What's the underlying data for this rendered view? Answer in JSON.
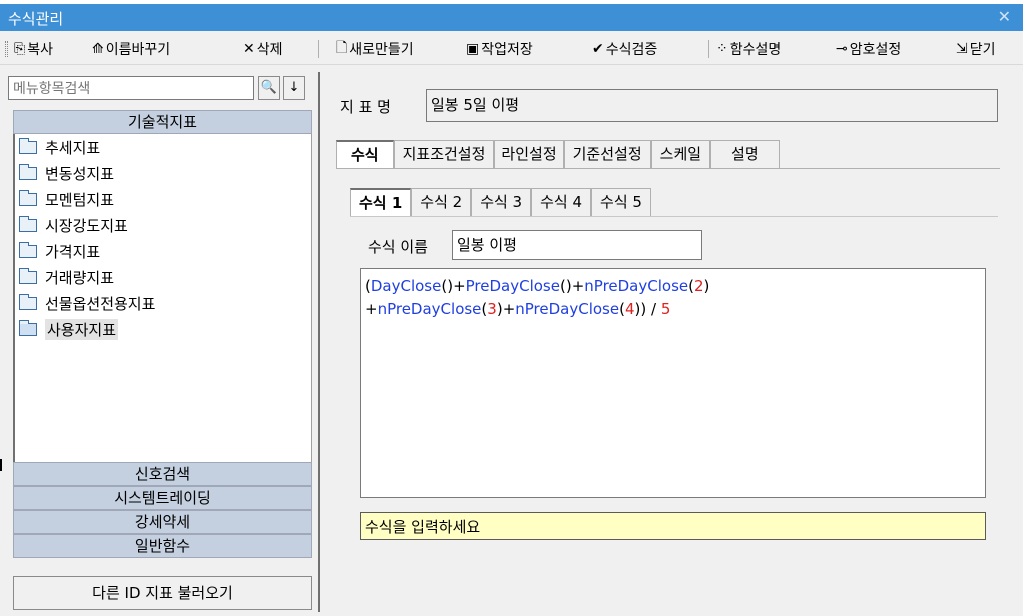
{
  "window": {
    "title": "수식관리",
    "close_glyph": "✕"
  },
  "toolbar": {
    "items": [
      {
        "label": "복사",
        "icon": "copy-icon",
        "glyph": "⎘"
      },
      {
        "label": "이름바꾸기",
        "icon": "rename-icon",
        "glyph": "⟰"
      },
      {
        "label": "삭제",
        "icon": "delete-icon",
        "glyph": "✕"
      },
      {
        "label": "새로만들기",
        "icon": "new-document-icon",
        "glyph": "🗋"
      },
      {
        "label": "작업저장",
        "icon": "save-icon",
        "glyph": "▣"
      },
      {
        "label": "수식검증",
        "icon": "check-icon",
        "glyph": "✔"
      },
      {
        "label": "함수설명",
        "icon": "magic-wand-icon",
        "glyph": "⁘"
      },
      {
        "label": "암호설정",
        "icon": "key-icon",
        "glyph": "⊸"
      },
      {
        "label": "닫기",
        "icon": "exit-icon",
        "glyph": "⇲"
      }
    ]
  },
  "left": {
    "search_placeholder": "메뉴항목검색",
    "search_button_glyph": "🔍",
    "down_button_glyph": "↓",
    "tree_header": "기술적지표",
    "tree_items": [
      {
        "label": "추세지표",
        "open": false
      },
      {
        "label": "변동성지표",
        "open": false
      },
      {
        "label": "모멘텀지표",
        "open": false
      },
      {
        "label": "시장강도지표",
        "open": false
      },
      {
        "label": "가격지표",
        "open": false
      },
      {
        "label": "거래량지표",
        "open": false
      },
      {
        "label": "선물옵션전용지표",
        "open": false
      },
      {
        "label": "사용자지표",
        "open": true
      }
    ],
    "sections": [
      "신호검색",
      "시스템트레이딩",
      "강세약세",
      "일반함수"
    ],
    "load_button": "다른 ID 지표 불러오기"
  },
  "right": {
    "indicator_name_label": "지 표 명",
    "indicator_name_value": "일봉 5일 이평",
    "tabs": [
      "수식",
      "지표조건설정",
      "라인설정",
      "기준선설정",
      "스케일",
      "설명"
    ],
    "active_tab": "수식",
    "formula_tabs": [
      "수식 1",
      "수식 2",
      "수식 3",
      "수식 4",
      "수식 5"
    ],
    "active_formula_tab": "수식 1",
    "formula_name_label": "수식 이름",
    "formula_name_value": "일봉 이평",
    "formula_lines": [
      [
        {
          "t": "(",
          "k": "op"
        },
        {
          "t": "DayClose",
          "k": "fn"
        },
        {
          "t": "()",
          "k": "op"
        },
        {
          "t": "+",
          "k": "op"
        },
        {
          "t": "PreDayClose",
          "k": "fn"
        },
        {
          "t": "()",
          "k": "op"
        },
        {
          "t": "+",
          "k": "op"
        },
        {
          "t": "nPreDayClose",
          "k": "fn"
        },
        {
          "t": "(",
          "k": "op"
        },
        {
          "t": "2",
          "k": "num"
        },
        {
          "t": ")",
          "k": "op"
        }
      ],
      [
        {
          "t": "+",
          "k": "op"
        },
        {
          "t": "nPreDayClose",
          "k": "fn"
        },
        {
          "t": "(",
          "k": "op"
        },
        {
          "t": "3",
          "k": "num"
        },
        {
          "t": ")",
          "k": "op"
        },
        {
          "t": "+",
          "k": "op"
        },
        {
          "t": "nPreDayClose",
          "k": "fn"
        },
        {
          "t": "(",
          "k": "op"
        },
        {
          "t": "4",
          "k": "num"
        },
        {
          "t": ")",
          "k": "op"
        },
        {
          "t": ") / ",
          "k": "op"
        },
        {
          "t": "5",
          "k": "num"
        }
      ]
    ],
    "hint_text": "수식을 입력하세요"
  },
  "colors": {
    "titlebar": "#3d8fd6",
    "function": "#1f3fe0",
    "number": "#e02020",
    "hint_bg": "#ffffc4",
    "section_bg": "#c4cfdf"
  }
}
